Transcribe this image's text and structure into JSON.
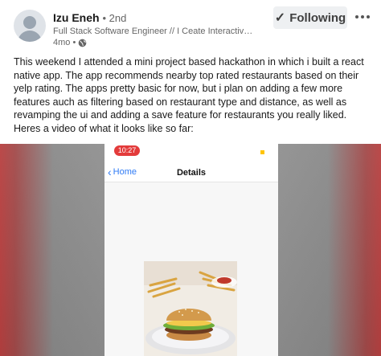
{
  "post": {
    "author_name": "Izu Eneh",
    "degree": "• 2nd",
    "headline": "Full Stack Software Engineer // I Ceate Interactive an...",
    "time": "4mo •",
    "follow_label": "Following",
    "body_text": "This weekend I attended a mini project based hackathon in which i built a react native app. The app recommends nearby top rated restaurants based on their yelp rating. The apps pretty basic for now, but i plan on adding a few more features auch as filtering based on restaurant type and distance, as well as revamping the ui and adding a save feature for restaurants you really liked. Heres a video of what it looks like so far:"
  },
  "video": {
    "status_time": "10:27",
    "back_label": "Home",
    "screen_title": "Details"
  },
  "icons": {
    "follow": "check-icon",
    "more": "more-dots-icon",
    "visibility": "globe-icon",
    "back": "chevron-left-icon"
  },
  "colors": {
    "accent_blue": "#2f7bf5",
    "status_red": "#e33b3b",
    "follow_bg": "#eef0f2"
  }
}
